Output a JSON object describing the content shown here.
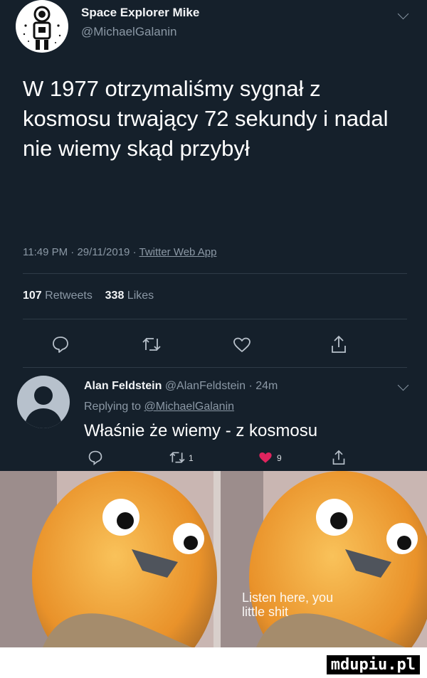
{
  "tweet": {
    "author_name": "Space Explorer Mike",
    "author_handle": "@MichaelGalanin",
    "text": "W 1977 otrzymaliśmy sygnał z kosmosu trwający 72 sekundy i nadal nie wiemy skąd przybył",
    "time": "11:49 PM",
    "date": "29/11/2019",
    "source": "Twitter Web App",
    "retweets_count": "107",
    "retweets_label": "Retweets",
    "likes_count": "338",
    "likes_label": "Likes",
    "separator": "·"
  },
  "reply": {
    "author_name": "Alan Feldstein",
    "author_handle": "@AlanFeldstein",
    "age": "24m",
    "replying_label": "Replying to",
    "replying_handle": "@MichaelGalanin",
    "text": "Właśnie że wiemy - z kosmosu",
    "retweet_count": "1",
    "like_count": "9"
  },
  "meme": {
    "caption_line1": "Listen here, you",
    "caption_line2": "little shit"
  },
  "watermark": "mdupiu.pl",
  "colors": {
    "background": "#15202b",
    "text": "#ffffff",
    "secondary": "#8b98a5",
    "like": "#e0245e",
    "bird": "#f2a33a"
  }
}
